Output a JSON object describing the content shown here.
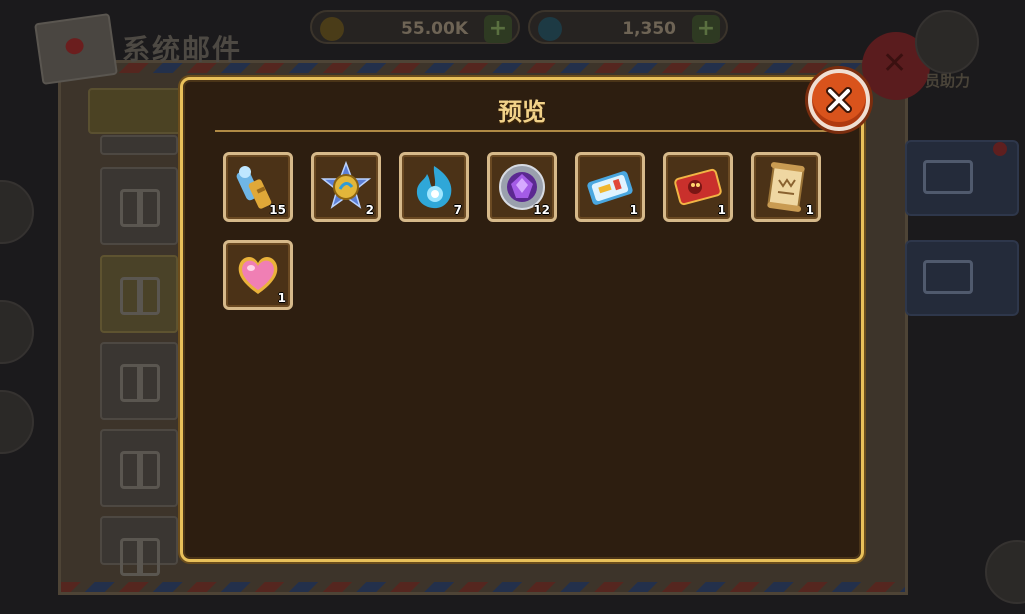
{
  "background": {
    "window_title": "系统邮件",
    "gold_amount": "55.00K",
    "gem_amount": "1,350",
    "right_label_top": "员助力",
    "currency_plus": "+"
  },
  "preview": {
    "title": "预览",
    "items": [
      {
        "icon": "spyglass-scroll-icon",
        "count": "15"
      },
      {
        "icon": "star-medal-icon",
        "count": "2"
      },
      {
        "icon": "blue-flame-spirit-icon",
        "count": "7"
      },
      {
        "icon": "purple-gem-icon",
        "count": "12"
      },
      {
        "icon": "ticket-icon",
        "count": "1"
      },
      {
        "icon": "red-card-icon",
        "count": "1"
      },
      {
        "icon": "parchment-scroll-icon",
        "count": "1"
      },
      {
        "icon": "pink-heart-icon",
        "count": "1"
      }
    ]
  },
  "colors": {
    "dialog_border": "#e8c05a",
    "dialog_bg": "#2d1e10",
    "title_text": "#f2d289",
    "close_button": "#d9531c"
  }
}
